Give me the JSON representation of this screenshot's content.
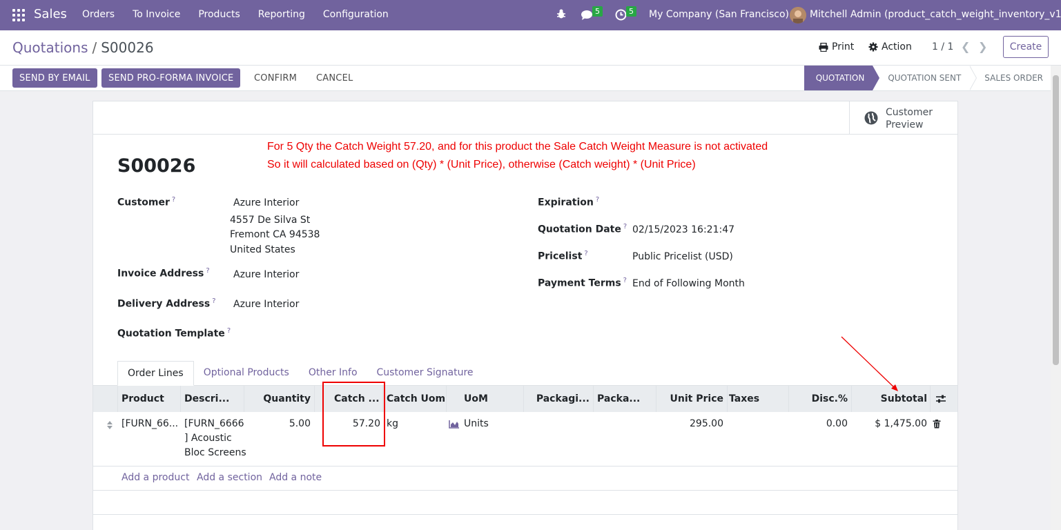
{
  "navbar": {
    "app": "Sales",
    "menu": [
      "Orders",
      "To Invoice",
      "Products",
      "Reporting",
      "Configuration"
    ],
    "chat_count": "5",
    "activity_count": "5",
    "company": "My Company (San Francisco)",
    "user": "Mitchell Admin (product_catch_weight_inventory_v16)"
  },
  "control": {
    "breadcrumb_parent": "Quotations",
    "breadcrumb_sep": "/",
    "breadcrumb_current": "S00026",
    "print": "Print",
    "action": "Action",
    "pager": "1 / 1",
    "create": "Create"
  },
  "statusbar": {
    "send_email": "SEND BY EMAIL",
    "send_proforma": "SEND PRO-FORMA INVOICE",
    "confirm": "CONFIRM",
    "cancel": "CANCEL",
    "stages": [
      "QUOTATION",
      "QUOTATION SENT",
      "SALES ORDER"
    ]
  },
  "sheet": {
    "preview": "Customer Preview",
    "note_line1": "For 5 Qty the Catch Weight 57.20, and for this product the Sale Catch Weight Measure is not activated",
    "note_line2": "So it will calculated based on (Qty) * (Unit Price), otherwise (Catch weight) * (Unit Price)",
    "title": "S00026",
    "fields": {
      "customer_label": "Customer",
      "customer": "Azure Interior",
      "addr1": "4557 De Silva St",
      "addr2": "Fremont CA 94538",
      "addr3": "United States",
      "invoice_label": "Invoice Address",
      "invoice": "Azure Interior",
      "delivery_label": "Delivery Address",
      "delivery": "Azure Interior",
      "template_label": "Quotation Template",
      "expiration_label": "Expiration",
      "quotation_date_label": "Quotation Date",
      "quotation_date": "02/15/2023 16:21:47",
      "pricelist_label": "Pricelist",
      "pricelist": "Public Pricelist (USD)",
      "payment_terms_label": "Payment Terms",
      "payment_terms": "End of Following Month",
      "help": "?"
    },
    "tabs": [
      "Order Lines",
      "Optional Products",
      "Other Info",
      "Customer Signature"
    ]
  },
  "table": {
    "headers": {
      "product": "Product",
      "description": "Descri...",
      "quantity": "Quantity",
      "catch": "Catch ...",
      "catch_uom": "Catch Uom",
      "uom": "UoM",
      "packaging": "Packagi...",
      "packa": "Packa...",
      "unit_price": "Unit Price",
      "taxes": "Taxes",
      "disc": "Disc.%",
      "subtotal": "Subtotal"
    },
    "row": {
      "product": "[FURN_66...",
      "desc1": "[FURN_6666",
      "desc2": "] Acoustic",
      "desc3": "Bloc Screens",
      "quantity": "5.00",
      "catch_weight": "57.20",
      "catch_uom": "kg",
      "uom": "Units",
      "unit_price": "295.00",
      "disc": "0.00",
      "subtotal": "$ 1,475.00"
    },
    "add_product": "Add a product",
    "add_section": "Add a section",
    "add_note": "Add a note"
  },
  "colors": {
    "brand": "#71639e",
    "annotation": "#e00000"
  }
}
